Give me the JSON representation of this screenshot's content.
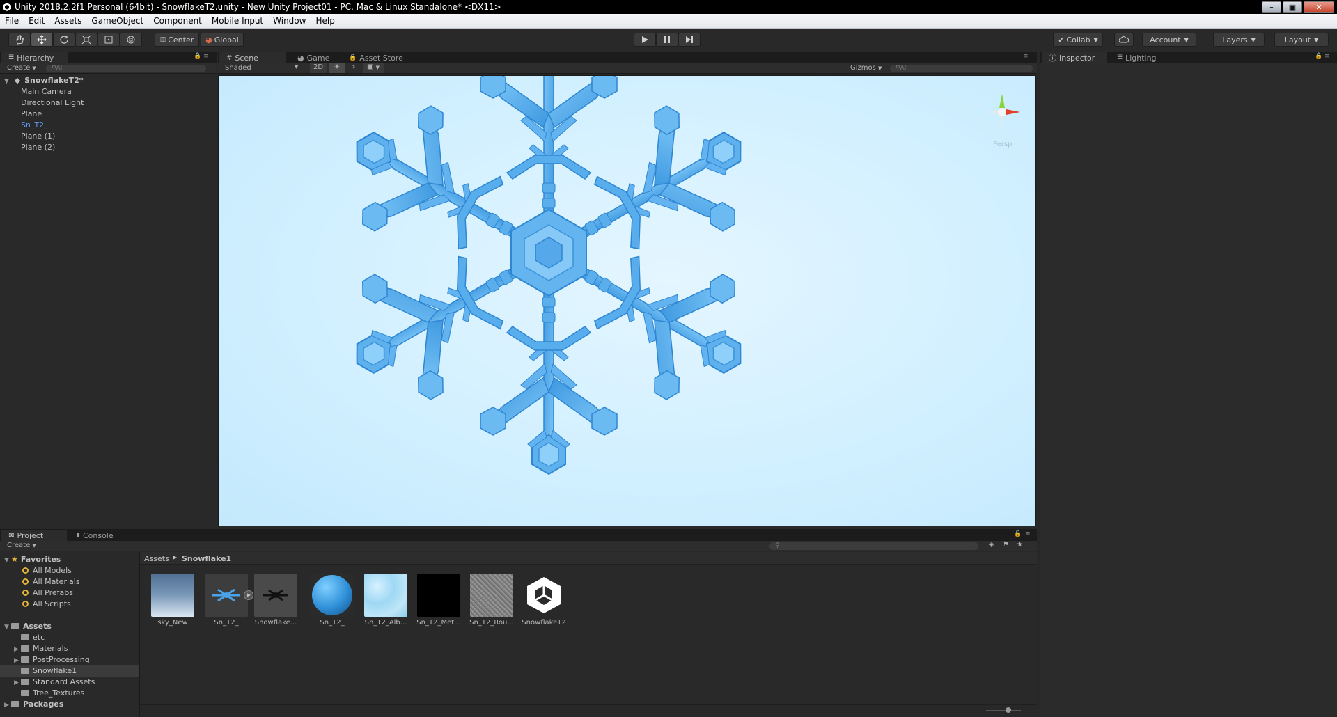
{
  "window": {
    "title": "Unity 2018.2.2f1 Personal (64bit) - SnowflakeT2.unity - New Unity Project01 - PC, Mac & Linux Standalone* <DX11>"
  },
  "menu": [
    "File",
    "Edit",
    "Assets",
    "GameObject",
    "Component",
    "Mobile Input",
    "Window",
    "Help"
  ],
  "toolbar": {
    "pivot": "Center",
    "space": "Global",
    "collab": "Collab",
    "account": "Account",
    "layers": "Layers",
    "layout": "Layout"
  },
  "hierarchy": {
    "tab": "Hierarchy",
    "create": "Create",
    "search_placeholder": "All",
    "scene": "SnowflakeT2*",
    "items": [
      "Main Camera",
      "Directional Light",
      "Plane",
      "Sn_T2_",
      "Plane (1)",
      "Plane (2)"
    ]
  },
  "scene": {
    "tabs": [
      "Scene",
      "Game",
      "Asset Store"
    ],
    "shading": "Shaded",
    "mode_2d": "2D",
    "gizmos": "Gizmos",
    "search_placeholder": "All",
    "persp": "Persp",
    "colors": {
      "background": "#d3f0ff",
      "flake": "#5eb2ef"
    }
  },
  "inspector": {
    "tabs": [
      "Inspector",
      "Lighting"
    ]
  },
  "project": {
    "tabs": [
      "Project",
      "Console"
    ],
    "create": "Create",
    "favorites_label": "Favorites",
    "favorites": [
      "All Models",
      "All Materials",
      "All Prefabs",
      "All Scripts"
    ],
    "assets_label": "Assets",
    "folders": [
      "etc",
      "Materials",
      "PostProcessing",
      "Snowflake1",
      "Standard Assets",
      "Tree_Textures"
    ],
    "packages_label": "Packages",
    "breadcrumb": [
      "Assets",
      "Snowflake1"
    ],
    "assets": [
      "sky_New",
      "Sn_T2_",
      "Snowflake...",
      "Sn_T2_",
      "Sn_T2_Alb...",
      "Sn_T2_Met...",
      "Sn_T2_Rou...",
      "SnowflakeT2"
    ]
  }
}
